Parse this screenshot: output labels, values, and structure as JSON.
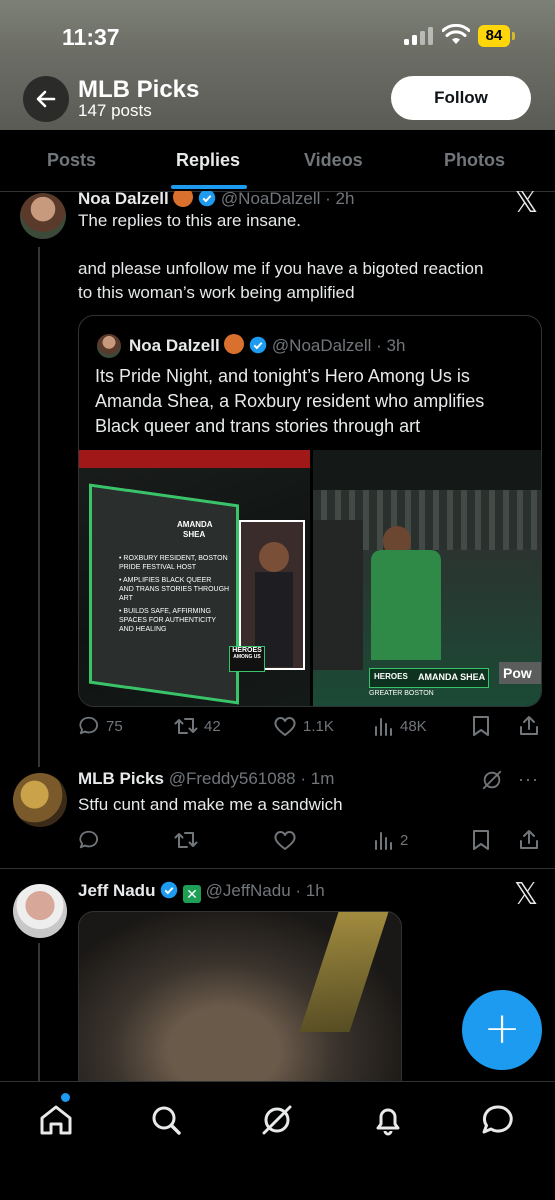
{
  "status_bar": {
    "time": "11:37",
    "battery": "84"
  },
  "header": {
    "name": "MLB Picks",
    "posts": "147 posts",
    "follow_label": "Follow"
  },
  "tabs": [
    {
      "label": "Posts",
      "active": false
    },
    {
      "label": "Replies",
      "active": true
    },
    {
      "label": "Videos",
      "active": false
    },
    {
      "label": "Photos",
      "active": false
    }
  ],
  "tweet1": {
    "name": "Noa Dalzell",
    "handle": "@NoaDalzell",
    "time": "· 2h",
    "line1": "The replies to this are insane.",
    "line2": "and please unfollow me if you have a bigoted reaction",
    "line3": "to this woman’s work being amplified",
    "quote": {
      "name": "Noa Dalzell",
      "handle": "@NoaDalzell",
      "time": "· 3h",
      "line1": "Its Pride Night, and tonight’s Hero Among Us is",
      "line2": "Amanda Shea, a Roxbury resident who amplifies",
      "line3": "Black queer and trans stories through art",
      "media_left": {
        "title1": "AMANDA",
        "title2": "SHEA",
        "bullet1a": "• ROXBURY RESIDENT, BOSTON",
        "bullet1b": "PRIDE FESTIVAL HOST",
        "bullet2a": "• AMPLIFIES BLACK QUEER",
        "bullet2b": "AND TRANS STORIES THROUGH",
        "bullet2c": "ART",
        "bullet3a": "• BUILDS SAFE, AFFIRMING",
        "bullet3b": "SPACES FOR AUTHENTICITY",
        "bullet3c": "AND HEALING",
        "badge1": "HEROES",
        "badge2": "AMONG US"
      },
      "media_right": {
        "banner_badge": "HEROES",
        "banner_name": "AMANDA SHEA",
        "banner_sub": "GREATER BOSTON",
        "edge_text": "Pow"
      }
    },
    "stats": {
      "replies": "75",
      "reposts": "42",
      "likes": "1.1K",
      "views": "48K"
    }
  },
  "tweet2": {
    "name": "MLB Picks",
    "handle": "@Freddy561088",
    "time": "· 1m",
    "text": "Stfu cunt and make me a sandwich",
    "stats": {
      "views": "2"
    }
  },
  "tweet3": {
    "name": "Jeff Nadu",
    "handle": "@JeffNadu",
    "time": "· 1h"
  },
  "icons": {
    "back": "arrow-left-icon",
    "home": "home-icon",
    "search": "search-icon",
    "grok": "grok-icon",
    "notifications": "bell-icon",
    "messages": "chat-icon",
    "compose": "plus-icon"
  },
  "colors": {
    "accent": "#1d9bf0",
    "background": "#000000",
    "text": "#e7e9ea",
    "muted": "#71767b"
  }
}
